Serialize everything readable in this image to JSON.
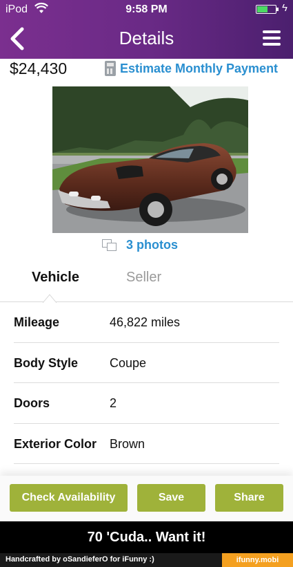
{
  "status_bar": {
    "carrier": "iPod",
    "time": "9:58 PM"
  },
  "nav": {
    "title": "Details"
  },
  "listing": {
    "price": "$24,430",
    "estimate_link": "Estimate Monthly Payment",
    "photos_link": "3 photos"
  },
  "tabs": [
    {
      "label": "Vehicle",
      "active": true
    },
    {
      "label": "Seller",
      "active": false
    }
  ],
  "specs": [
    {
      "label": "Mileage",
      "value": "46,822 miles"
    },
    {
      "label": "Body Style",
      "value": "Coupe"
    },
    {
      "label": "Doors",
      "value": "2"
    },
    {
      "label": "Exterior Color",
      "value": "Brown"
    }
  ],
  "actions": {
    "check_availability": "Check Availability",
    "save": "Save",
    "share": "Share"
  },
  "caption": "70 'Cuda.. Want it!",
  "footer": {
    "credit": "Handcrafted by oSandieferO for iFunny :)",
    "brand": "ifunny.mobi"
  },
  "colors": {
    "header_gradient": [
      "#7b2f8f",
      "#4b1f6e"
    ],
    "link": "#2a8fd0",
    "button": "#9fb23a",
    "battery": "#4cd964",
    "footer_badge": "#f4a020"
  },
  "icons": [
    "wifi-icon",
    "battery-icon",
    "back-chevron-icon",
    "menu-icon",
    "calculator-icon",
    "photos-stack-icon"
  ]
}
